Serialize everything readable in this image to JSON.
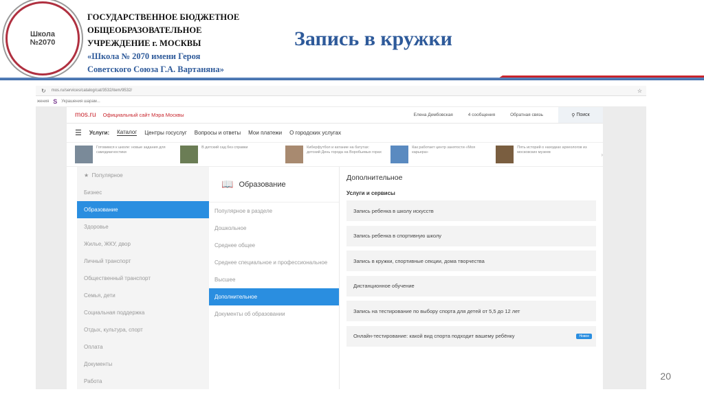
{
  "header": {
    "logo_text": "Школа №2070",
    "org_lines": [
      "ГОСУДАРСТВЕННОЕ БЮДЖЕТНОЕ",
      "ОБЩЕОБРАЗОВАТЕЛЬНОЕ",
      "УЧРЕЖДЕНИЕ г. МОСКВЫ"
    ],
    "school_lines": [
      "«Школа № 2070 имени Героя",
      "Советского Союза Г.А. Вартаняна»"
    ],
    "title": "Запись в кружки"
  },
  "browser": {
    "url": "mos.ru/services/catalog/cat/3532/item/9532/",
    "bookmarks": [
      "жения",
      "Украшения шарам..."
    ]
  },
  "site": {
    "logo": "mos.ru",
    "tagline": "Официальный сайт Мэра Москвы",
    "user": "Елена Дембовская",
    "messages": "4 сообщения",
    "feedback": "Обратная связь",
    "search": "Поиск",
    "nav_label": "Услуги:",
    "nav": [
      "Каталог",
      "Центры госуслуг",
      "Вопросы и ответы",
      "Мои платежи",
      "О городских услугах"
    ],
    "news": [
      "Готовимся к школе: новые задания для самодиагностики",
      "В детский сад без справки",
      "Киберфутбол и катание на батутах: детский День города на Воробьевых горах",
      "Как работает центр занятости «Моя карьера»",
      "Пять историй о находках археологов из московских музеев"
    ],
    "categories": [
      "Популярное",
      "Бизнес",
      "Образование",
      "Здоровье",
      "Жилье, ЖКУ, двор",
      "Личный транспорт",
      "Общественный транспорт",
      "Семья, дети",
      "Социальная поддержка",
      "Отдых, культура, спорт",
      "Оплата",
      "Документы",
      "Работа"
    ],
    "section_title": "Образование",
    "subcategories": [
      "Популярное в разделе",
      "Дошкольное",
      "Среднее общее",
      "Среднее специальное и профессиональное",
      "Высшее",
      "Дополнительное",
      "Документы об образовании"
    ],
    "right_title": "Дополнительное",
    "services_label": "Услуги и сервисы",
    "services": [
      "Запись ребенка в школу искусств",
      "Запись ребенка в спортивную школу",
      "Запись в кружки, спортивные секции, дома творчества",
      "Дистанционное обучение",
      "Запись на тестирование по выбору спорта для детей от 5,5 до 12 лет",
      "Онлайн-тестирование: какой вид спорта подходит вашему ребёнку"
    ],
    "new_badge": "Новое"
  },
  "page_number": "20"
}
